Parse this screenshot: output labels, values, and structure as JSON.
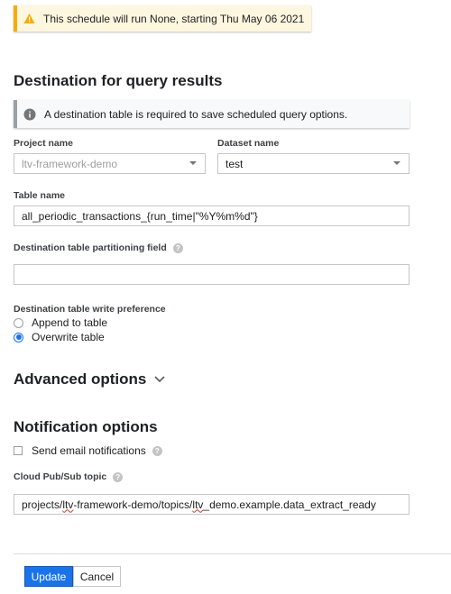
{
  "warning_banner": {
    "text": "This schedule will run None, starting Thu May 06 2021",
    "icon": "warning-icon"
  },
  "destination": {
    "title": "Destination for query results",
    "info_text": "A destination table is required to save scheduled query options.",
    "project": {
      "label": "Project name",
      "value": "ltv-framework-demo",
      "disabled": true
    },
    "dataset": {
      "label": "Dataset name",
      "value": "test"
    },
    "table": {
      "label": "Table name",
      "value": "all_periodic_transactions_{run_time|\"%Y%m%d\"}"
    },
    "partition": {
      "label": "Destination table partitioning field",
      "value": ""
    },
    "write_pref": {
      "label": "Destination table write preference",
      "options": [
        "Append to table",
        "Overwrite table"
      ],
      "selected": "Overwrite table"
    }
  },
  "advanced": {
    "title": "Advanced options"
  },
  "notifications": {
    "title": "Notification options",
    "email_label": "Send email notifications",
    "email_checked": false,
    "pubsub": {
      "label": "Cloud Pub/Sub topic",
      "value_parts": [
        "projects/",
        "ltv",
        "-framework-demo/topics/",
        "ltv",
        "_demo.example.data_extract_ready"
      ]
    }
  },
  "actions": {
    "update_label": "Update",
    "cancel_label": "Cancel"
  },
  "colors": {
    "accent": "#1a73e8",
    "warning": "#f9ab00",
    "warning_bg": "#fef7e0"
  }
}
